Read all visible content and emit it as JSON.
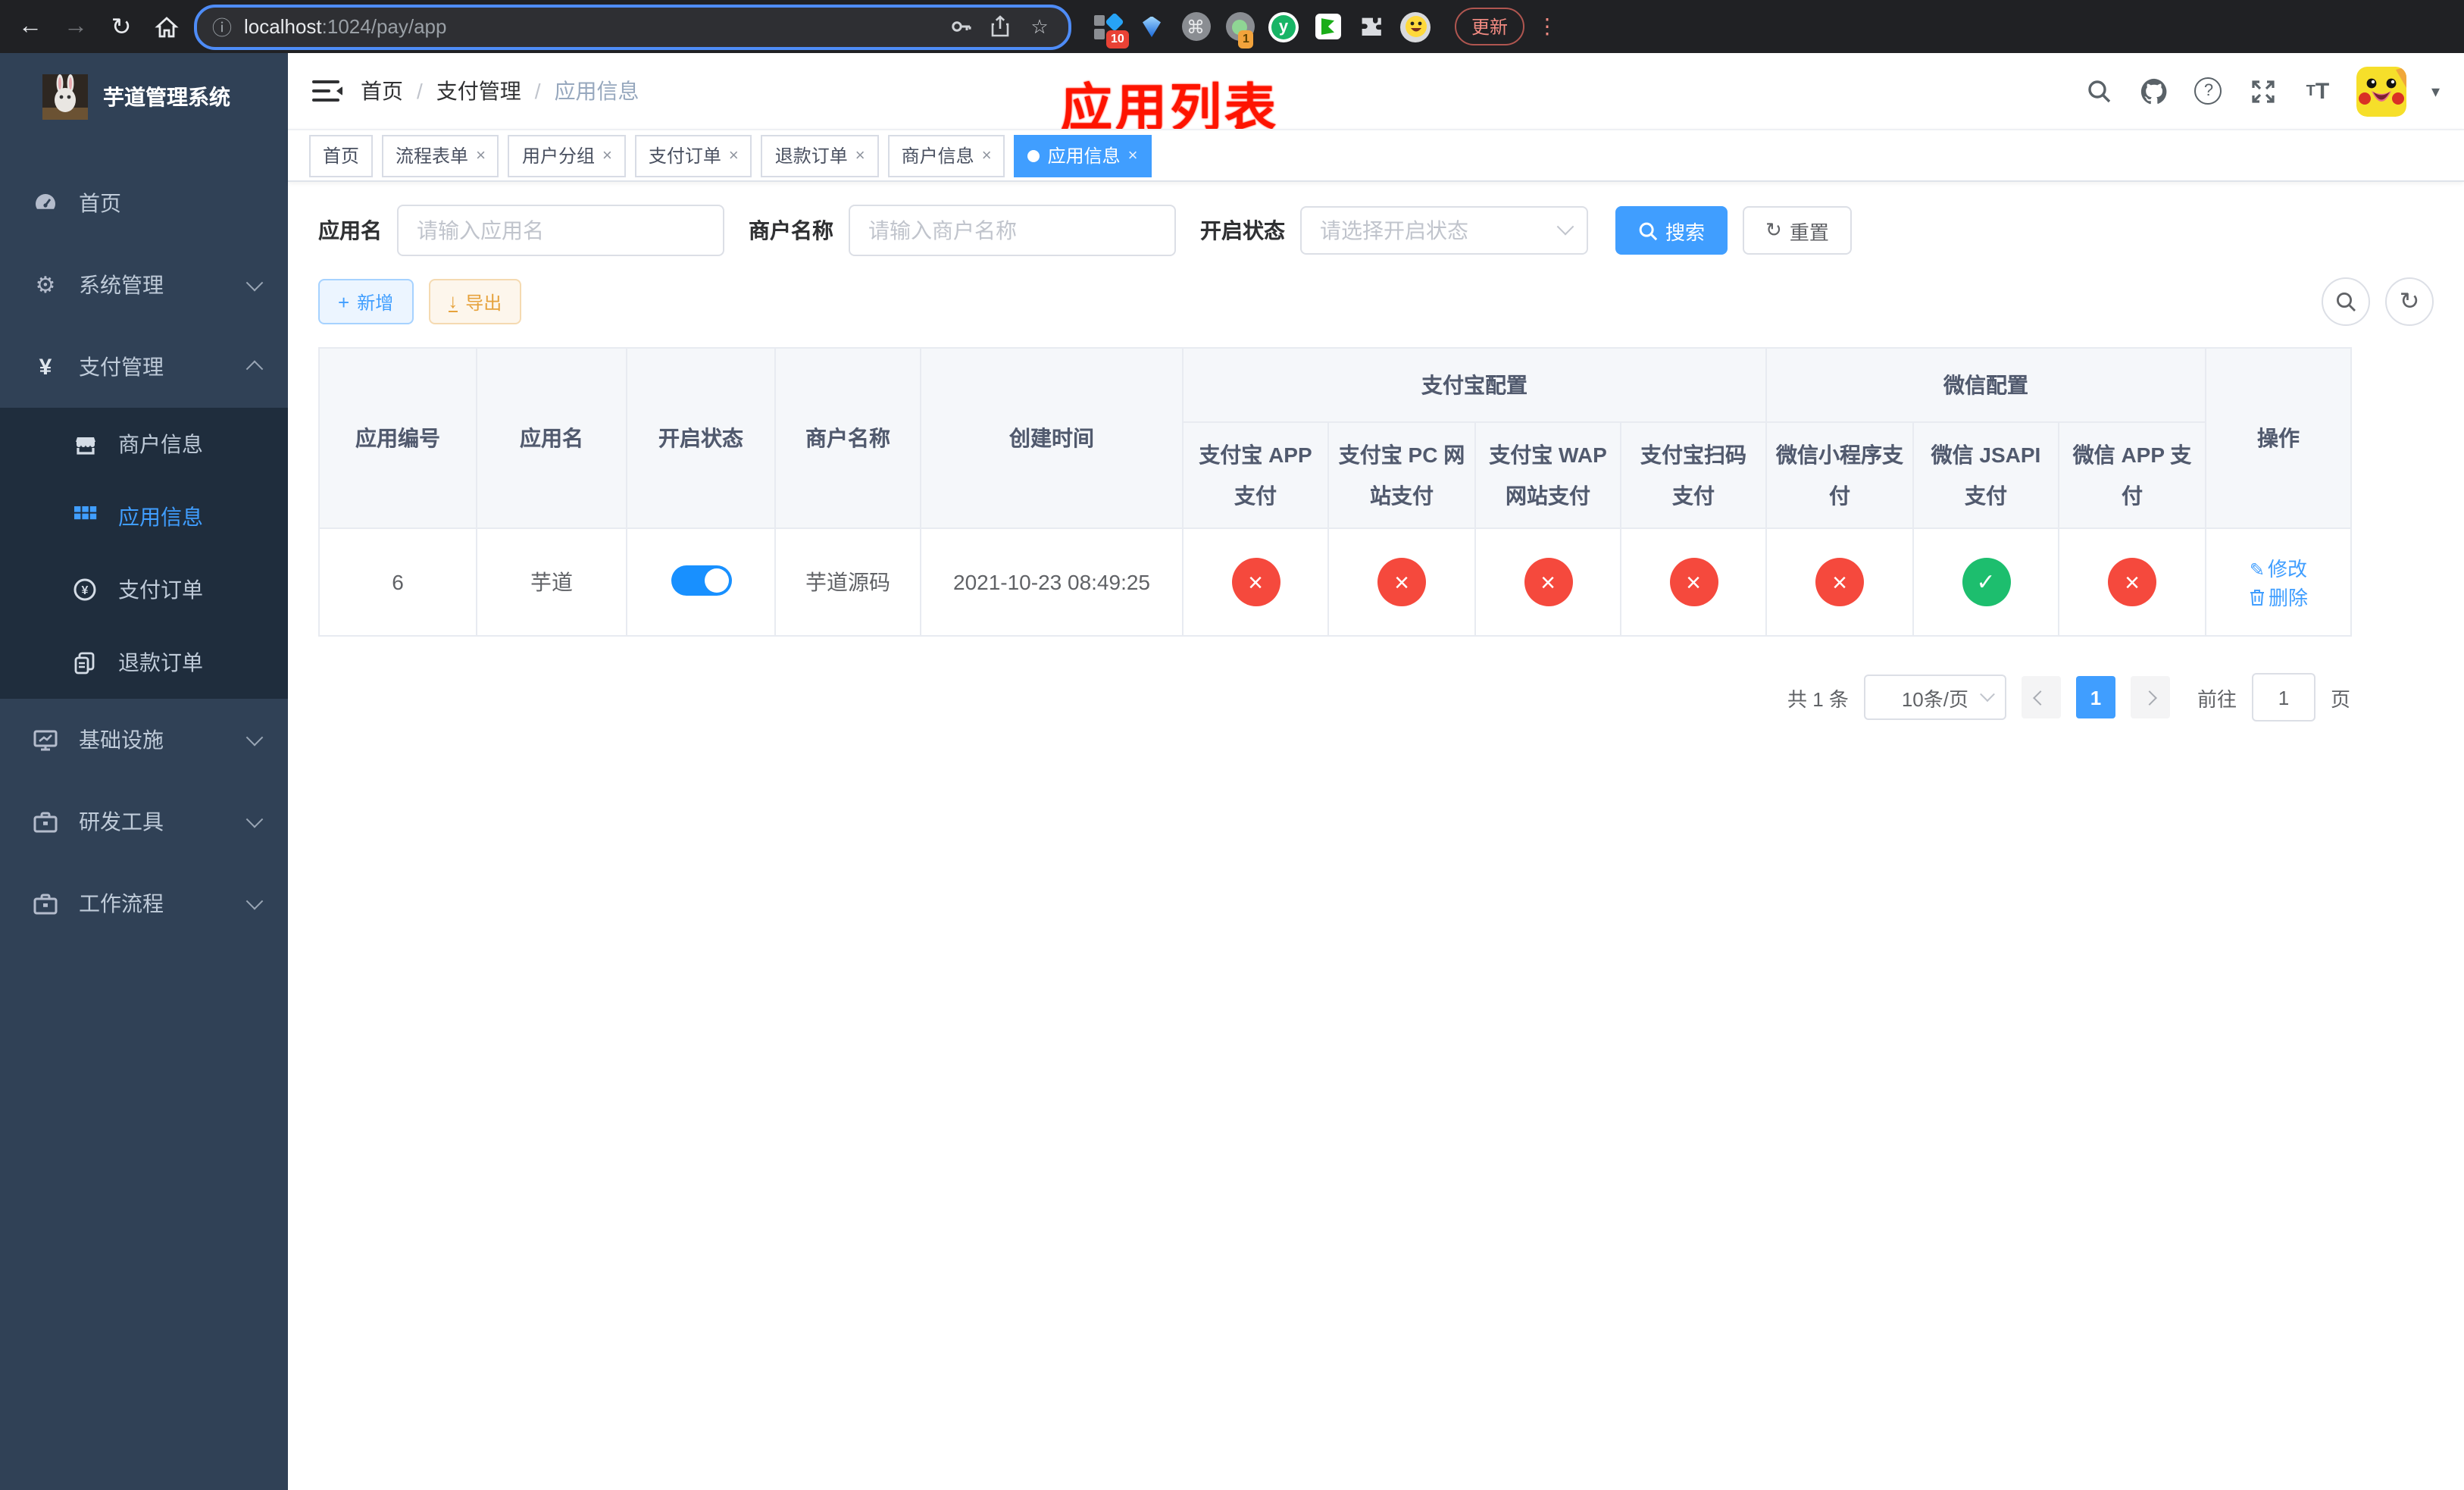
{
  "browser": {
    "url_host": "localhost",
    "url_rest": ":1024/pay/app",
    "update_button": "更新",
    "ext_badge_blue_diamond": "10",
    "ext_badge_green_dot": "1"
  },
  "sidebar": {
    "title": "芋道管理系统",
    "menu": [
      {
        "label": "首页",
        "icon": "dashboard-icon"
      },
      {
        "label": "系统管理",
        "icon": "gear-icon",
        "state": "collapsed"
      },
      {
        "label": "支付管理",
        "icon": "yen-icon",
        "state": "expanded"
      },
      {
        "label": "基础设施",
        "icon": "monitor-icon",
        "state": "collapsed"
      },
      {
        "label": "研发工具",
        "icon": "toolbox-icon",
        "state": "collapsed"
      },
      {
        "label": "工作流程",
        "icon": "toolbox-icon",
        "state": "collapsed"
      }
    ],
    "pay_submenu": [
      {
        "label": "商户信息",
        "icon": "shop-icon",
        "active": false
      },
      {
        "label": "应用信息",
        "icon": "grid-icon",
        "active": true
      },
      {
        "label": "支付订单",
        "icon": "yen-circle-icon",
        "active": false
      },
      {
        "label": "退款订单",
        "icon": "document-icon",
        "active": false
      }
    ]
  },
  "header": {
    "breadcrumb": [
      "首页",
      "支付管理",
      "应用信息"
    ],
    "overlay_title": "应用列表"
  },
  "tabs": [
    {
      "label": "首页",
      "closable": false,
      "active": false
    },
    {
      "label": "流程表单",
      "closable": true,
      "active": false
    },
    {
      "label": "用户分组",
      "closable": true,
      "active": false
    },
    {
      "label": "支付订单",
      "closable": true,
      "active": false
    },
    {
      "label": "退款订单",
      "closable": true,
      "active": false
    },
    {
      "label": "商户信息",
      "closable": true,
      "active": false
    },
    {
      "label": "应用信息",
      "closable": true,
      "active": true
    }
  ],
  "filters": {
    "app_name_label": "应用名",
    "app_name_placeholder": "请输入应用名",
    "merchant_label": "商户名称",
    "merchant_placeholder": "请输入商户名称",
    "status_label": "开启状态",
    "status_placeholder": "请选择开启状态",
    "search_label": "搜索",
    "reset_label": "重置"
  },
  "toolbar": {
    "add_label": "新增",
    "export_label": "导出"
  },
  "table": {
    "col_headers": [
      "应用编号",
      "应用名",
      "开启状态",
      "商户名称",
      "创建时间"
    ],
    "group_alipay": "支付宝配置",
    "group_wechat": "微信配置",
    "pay_headers": [
      "支付宝 APP 支付",
      "支付宝 PC 网站支付",
      "支付宝 WAP 网站支付",
      "支付宝扫码支付",
      "微信小程序支付",
      "微信 JSAPI 支付",
      "微信 APP 支付"
    ],
    "ops_header": "操作",
    "row": {
      "id": "6",
      "name": "芋道",
      "enabled": true,
      "merchant": "芋道源码",
      "created": "2021-10-23 08:49:25",
      "pay_status": [
        "no",
        "no",
        "no",
        "no",
        "no",
        "yes",
        "no"
      ],
      "edit_label": "修改",
      "delete_label": "删除"
    }
  },
  "pagination": {
    "total": "共 1 条",
    "page_size": "10条/页",
    "page": "1",
    "goto_prefix": "前往",
    "goto_value": "1",
    "goto_suffix": "页"
  },
  "colors": {
    "accent": "#409eff",
    "toggle_on": "#1890ff",
    "danger": "#f5493d",
    "success": "#1dbe6e",
    "warning": "#e6a23c",
    "sidebar_bg": "#304156",
    "submenu_bg": "#1f2d3d",
    "overlay_title": "#fe1400"
  }
}
